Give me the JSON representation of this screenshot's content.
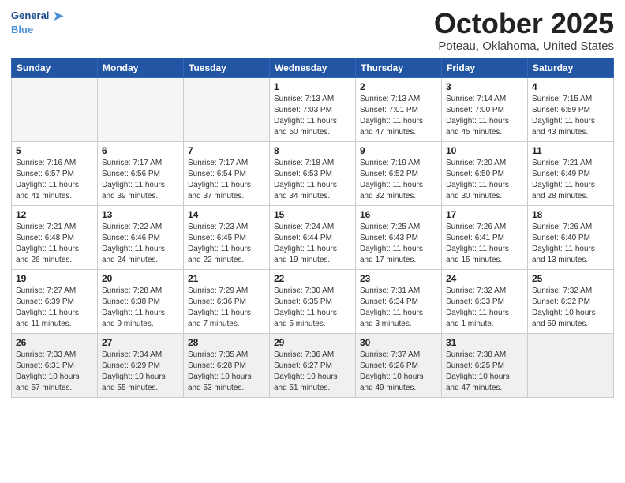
{
  "header": {
    "logo_line1": "General",
    "logo_line2": "Blue",
    "title": "October 2025",
    "location": "Poteau, Oklahoma, United States"
  },
  "weekdays": [
    "Sunday",
    "Monday",
    "Tuesday",
    "Wednesday",
    "Thursday",
    "Friday",
    "Saturday"
  ],
  "weeks": [
    [
      {
        "day": "",
        "info": ""
      },
      {
        "day": "",
        "info": ""
      },
      {
        "day": "",
        "info": ""
      },
      {
        "day": "1",
        "info": "Sunrise: 7:13 AM\nSunset: 7:03 PM\nDaylight: 11 hours\nand 50 minutes."
      },
      {
        "day": "2",
        "info": "Sunrise: 7:13 AM\nSunset: 7:01 PM\nDaylight: 11 hours\nand 47 minutes."
      },
      {
        "day": "3",
        "info": "Sunrise: 7:14 AM\nSunset: 7:00 PM\nDaylight: 11 hours\nand 45 minutes."
      },
      {
        "day": "4",
        "info": "Sunrise: 7:15 AM\nSunset: 6:59 PM\nDaylight: 11 hours\nand 43 minutes."
      }
    ],
    [
      {
        "day": "5",
        "info": "Sunrise: 7:16 AM\nSunset: 6:57 PM\nDaylight: 11 hours\nand 41 minutes."
      },
      {
        "day": "6",
        "info": "Sunrise: 7:17 AM\nSunset: 6:56 PM\nDaylight: 11 hours\nand 39 minutes."
      },
      {
        "day": "7",
        "info": "Sunrise: 7:17 AM\nSunset: 6:54 PM\nDaylight: 11 hours\nand 37 minutes."
      },
      {
        "day": "8",
        "info": "Sunrise: 7:18 AM\nSunset: 6:53 PM\nDaylight: 11 hours\nand 34 minutes."
      },
      {
        "day": "9",
        "info": "Sunrise: 7:19 AM\nSunset: 6:52 PM\nDaylight: 11 hours\nand 32 minutes."
      },
      {
        "day": "10",
        "info": "Sunrise: 7:20 AM\nSunset: 6:50 PM\nDaylight: 11 hours\nand 30 minutes."
      },
      {
        "day": "11",
        "info": "Sunrise: 7:21 AM\nSunset: 6:49 PM\nDaylight: 11 hours\nand 28 minutes."
      }
    ],
    [
      {
        "day": "12",
        "info": "Sunrise: 7:21 AM\nSunset: 6:48 PM\nDaylight: 11 hours\nand 26 minutes."
      },
      {
        "day": "13",
        "info": "Sunrise: 7:22 AM\nSunset: 6:46 PM\nDaylight: 11 hours\nand 24 minutes."
      },
      {
        "day": "14",
        "info": "Sunrise: 7:23 AM\nSunset: 6:45 PM\nDaylight: 11 hours\nand 22 minutes."
      },
      {
        "day": "15",
        "info": "Sunrise: 7:24 AM\nSunset: 6:44 PM\nDaylight: 11 hours\nand 19 minutes."
      },
      {
        "day": "16",
        "info": "Sunrise: 7:25 AM\nSunset: 6:43 PM\nDaylight: 11 hours\nand 17 minutes."
      },
      {
        "day": "17",
        "info": "Sunrise: 7:26 AM\nSunset: 6:41 PM\nDaylight: 11 hours\nand 15 minutes."
      },
      {
        "day": "18",
        "info": "Sunrise: 7:26 AM\nSunset: 6:40 PM\nDaylight: 11 hours\nand 13 minutes."
      }
    ],
    [
      {
        "day": "19",
        "info": "Sunrise: 7:27 AM\nSunset: 6:39 PM\nDaylight: 11 hours\nand 11 minutes."
      },
      {
        "day": "20",
        "info": "Sunrise: 7:28 AM\nSunset: 6:38 PM\nDaylight: 11 hours\nand 9 minutes."
      },
      {
        "day": "21",
        "info": "Sunrise: 7:29 AM\nSunset: 6:36 PM\nDaylight: 11 hours\nand 7 minutes."
      },
      {
        "day": "22",
        "info": "Sunrise: 7:30 AM\nSunset: 6:35 PM\nDaylight: 11 hours\nand 5 minutes."
      },
      {
        "day": "23",
        "info": "Sunrise: 7:31 AM\nSunset: 6:34 PM\nDaylight: 11 hours\nand 3 minutes."
      },
      {
        "day": "24",
        "info": "Sunrise: 7:32 AM\nSunset: 6:33 PM\nDaylight: 11 hours\nand 1 minute."
      },
      {
        "day": "25",
        "info": "Sunrise: 7:32 AM\nSunset: 6:32 PM\nDaylight: 10 hours\nand 59 minutes."
      }
    ],
    [
      {
        "day": "26",
        "info": "Sunrise: 7:33 AM\nSunset: 6:31 PM\nDaylight: 10 hours\nand 57 minutes."
      },
      {
        "day": "27",
        "info": "Sunrise: 7:34 AM\nSunset: 6:29 PM\nDaylight: 10 hours\nand 55 minutes."
      },
      {
        "day": "28",
        "info": "Sunrise: 7:35 AM\nSunset: 6:28 PM\nDaylight: 10 hours\nand 53 minutes."
      },
      {
        "day": "29",
        "info": "Sunrise: 7:36 AM\nSunset: 6:27 PM\nDaylight: 10 hours\nand 51 minutes."
      },
      {
        "day": "30",
        "info": "Sunrise: 7:37 AM\nSunset: 6:26 PM\nDaylight: 10 hours\nand 49 minutes."
      },
      {
        "day": "31",
        "info": "Sunrise: 7:38 AM\nSunset: 6:25 PM\nDaylight: 10 hours\nand 47 minutes."
      },
      {
        "day": "",
        "info": ""
      }
    ]
  ]
}
